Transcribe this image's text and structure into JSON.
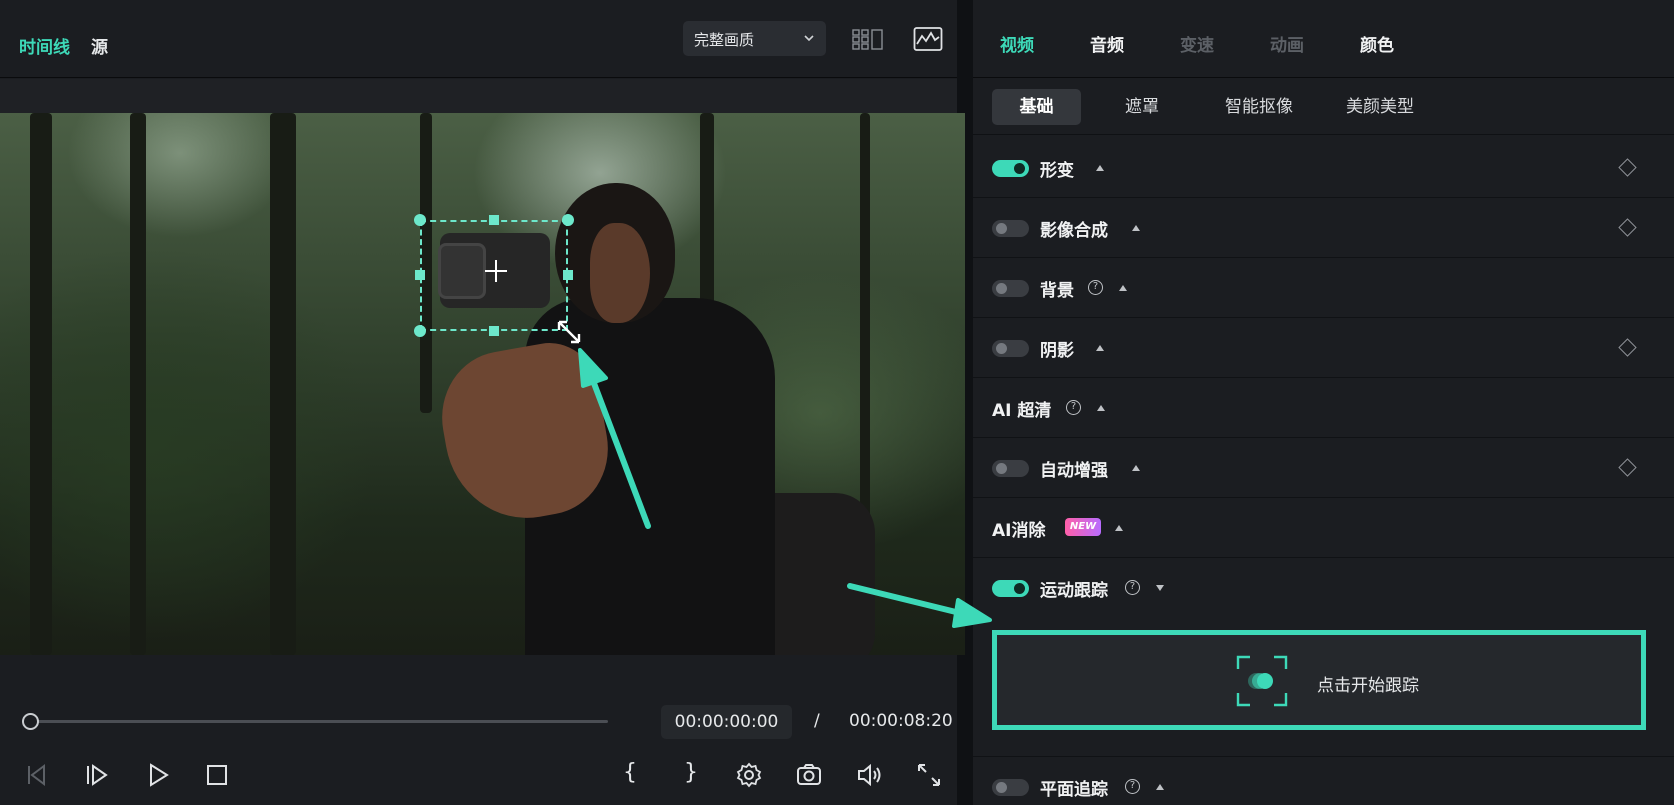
{
  "player": {
    "tab_timeline": "时间线",
    "tab_source": "源",
    "quality": "完整画质",
    "time_current": "00:00:00:00",
    "time_separator": "/",
    "time_total": "00:00:08:20",
    "playback_progress": 0.0
  },
  "props": {
    "tabs": [
      {
        "label": "视频",
        "state": "active"
      },
      {
        "label": "音频",
        "state": "enabled"
      },
      {
        "label": "变速",
        "state": "disabled"
      },
      {
        "label": "动画",
        "state": "disabled"
      },
      {
        "label": "颜色",
        "state": "enabled"
      }
    ],
    "subtabs": [
      "基础",
      "遮罩",
      "智能抠像",
      "美颜美型"
    ],
    "rows": [
      {
        "label": "形变",
        "toggle": "on",
        "keyframe": true
      },
      {
        "label": "影像合成",
        "toggle": "off",
        "keyframe": true
      },
      {
        "label": "背景",
        "toggle": "off",
        "help": true
      },
      {
        "label": "阴影",
        "toggle": "off",
        "keyframe": true
      },
      {
        "label": "AI 超清",
        "help": true
      },
      {
        "label": "自动增强",
        "toggle": "off",
        "keyframe": true
      },
      {
        "label": "AI消除",
        "badge": "NEW"
      },
      {
        "label": "运动跟踪",
        "toggle": "on",
        "help": true,
        "expanded": true
      },
      {
        "label": "平面追踪",
        "toggle": "off",
        "help": true
      }
    ],
    "tracking_button": "点击开始跟踪"
  },
  "colors": {
    "accent": "#3dd9b8",
    "panel": "#1b1d21",
    "badge_gradient": [
      "#ff5fa8",
      "#b86cff"
    ]
  },
  "icons": {
    "grid_view": "grid-icon",
    "scope": "waveform-scope-icon",
    "controls": [
      "prev-frame-icon",
      "next-frame-icon",
      "play-icon",
      "stop-icon",
      "mark-in-icon",
      "mark-out-icon",
      "settings-icon",
      "snapshot-icon",
      "volume-icon",
      "fullscreen-icon"
    ]
  }
}
